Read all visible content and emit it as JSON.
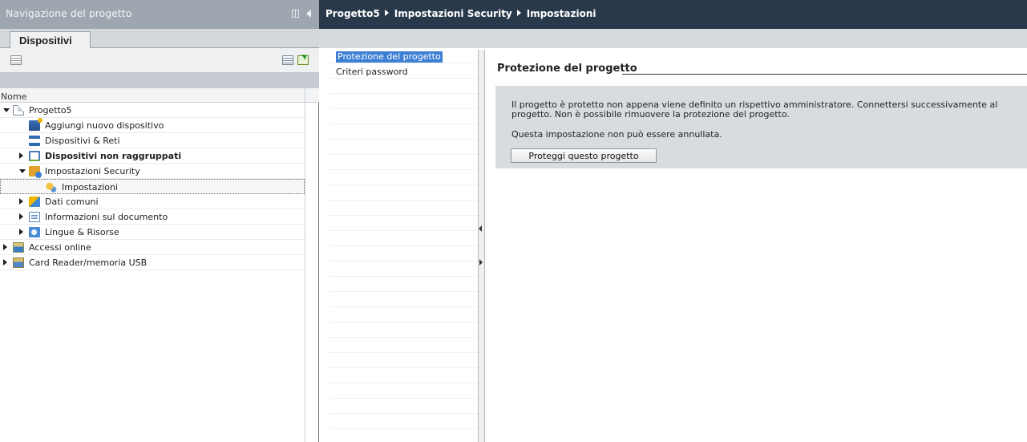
{
  "nav": {
    "title": "Navigazione del progetto",
    "tab_label": "Dispositivi",
    "column_header": "Nome",
    "tree": [
      {
        "label": "Progetto5",
        "indent": 1,
        "toggle": "open",
        "icon": "project-icon",
        "bold": false
      },
      {
        "label": "Aggiungi nuovo dispositivo",
        "indent": 2,
        "toggle": "none",
        "icon": "add-device-icon",
        "bold": false
      },
      {
        "label": "Dispositivi & Reti",
        "indent": 2,
        "toggle": "none",
        "icon": "network-icon",
        "bold": false
      },
      {
        "label": "Dispositivi non raggruppati",
        "indent": 2,
        "toggle": "closed",
        "icon": "ungrouped-devices-icon",
        "bold": true
      },
      {
        "label": "Impostazioni Security",
        "indent": 2,
        "toggle": "open",
        "icon": "security-settings-icon",
        "bold": false
      },
      {
        "label": "Impostazioni",
        "indent": 3,
        "toggle": "none",
        "icon": "settings-icon",
        "bold": false,
        "selected": true
      },
      {
        "label": "Dati comuni",
        "indent": 2,
        "toggle": "closed",
        "icon": "common-data-icon",
        "bold": false
      },
      {
        "label": "Informazioni sul documento",
        "indent": 2,
        "toggle": "closed",
        "icon": "document-info-icon",
        "bold": false
      },
      {
        "label": "Lingue & Risorse",
        "indent": 2,
        "toggle": "closed",
        "icon": "languages-icon",
        "bold": false
      },
      {
        "label": "Accessi online",
        "indent": 1,
        "toggle": "closed",
        "icon": "online-access-icon",
        "bold": false
      },
      {
        "label": "Card Reader/memoria USB",
        "indent": 1,
        "toggle": "closed",
        "icon": "card-reader-icon",
        "bold": false
      }
    ]
  },
  "breadcrumb": [
    "Progetto5",
    "Impostazioni Security",
    "Impostazioni"
  ],
  "settings_list": [
    {
      "label": "Protezione del progetto",
      "selected": true
    },
    {
      "label": "Criteri password",
      "selected": false
    }
  ],
  "content": {
    "section_title": "Protezione del progetto",
    "paragraph1": "Il progetto è protetto non appena viene definito un rispettivo amministratore. Connettersi successivamente al progetto. Non è possibile rimuovere la protezione del progetto.",
    "paragraph2": "Questa impostazione non può essere annullata.",
    "button_label": "Proteggi questo progetto"
  },
  "colors": {
    "nav_title_bg": "#9ea7b0",
    "main_title_bg": "#29384a",
    "selection": "#3d7fd3"
  }
}
